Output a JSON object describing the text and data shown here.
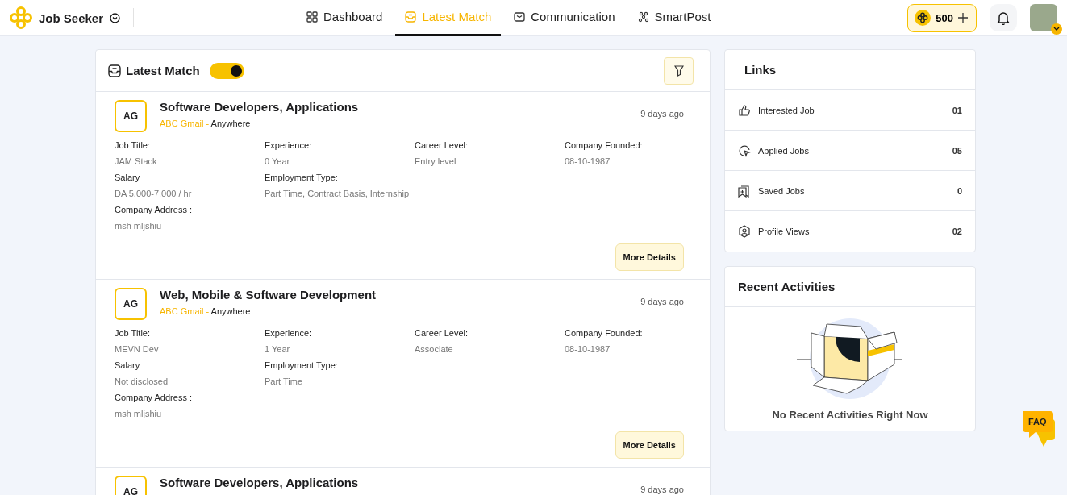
{
  "header": {
    "brand": "Job Seeker",
    "nav": [
      {
        "label": "Dashboard",
        "selected": false
      },
      {
        "label": "Latest Match",
        "selected": true
      },
      {
        "label": "Communication",
        "selected": false
      },
      {
        "label": "SmartPost",
        "selected": false
      }
    ],
    "coins": "500"
  },
  "latest_match": {
    "title": "Latest Match",
    "toggle_on": true,
    "jobs": [
      {
        "logo": "AG",
        "title": "Software Developers, Applications",
        "company": "ABC Gmail -",
        "location": "Anywhere",
        "posted": "9 days ago",
        "button": "More Details",
        "field_rows": [
          [
            {
              "label": "Job Title:",
              "value": "JAM Stack"
            },
            {
              "label": "Experience:",
              "value": "0 Year"
            },
            {
              "label": "Career Level:",
              "value": "Entry level"
            },
            {
              "label": "Company Founded:",
              "value": "08-10-1987"
            }
          ],
          [
            {
              "label": "Salary",
              "value": "DA 5,000-7,000 / hr"
            },
            {
              "label": "Employment Type:",
              "value": "Part Time, Contract Basis, Internship"
            }
          ],
          [
            {
              "label": "Company Address :",
              "value": "msh mljshiu"
            }
          ]
        ]
      },
      {
        "logo": "AG",
        "title": "Web, Mobile & Software Development",
        "company": "ABC Gmail -",
        "location": "Anywhere",
        "posted": "9 days ago",
        "button": "More Details",
        "field_rows": [
          [
            {
              "label": "Job Title:",
              "value": "MEVN Dev"
            },
            {
              "label": "Experience:",
              "value": "1 Year"
            },
            {
              "label": "Career Level:",
              "value": "Associate"
            },
            {
              "label": "Company Founded:",
              "value": "08-10-1987"
            }
          ],
          [
            {
              "label": "Salary",
              "value": "Not disclosed"
            },
            {
              "label": "Employment Type:",
              "value": "Part Time"
            }
          ],
          [
            {
              "label": "Company Address :",
              "value": "msh mljshiu"
            }
          ]
        ]
      },
      {
        "logo": "AG",
        "title": "Software Developers, Applications",
        "posted": "9 days ago"
      }
    ]
  },
  "links": {
    "title": "Links",
    "items": [
      {
        "label": "Interested Job",
        "count": "01"
      },
      {
        "label": "Applied Jobs",
        "count": "05"
      },
      {
        "label": "Saved Jobs",
        "count": "0"
      },
      {
        "label": "Profile Views",
        "count": "02"
      }
    ]
  },
  "recent_activities": {
    "title": "Recent Activities",
    "empty_text": "No Recent Activities Right Now"
  },
  "faq": "FAQ"
}
